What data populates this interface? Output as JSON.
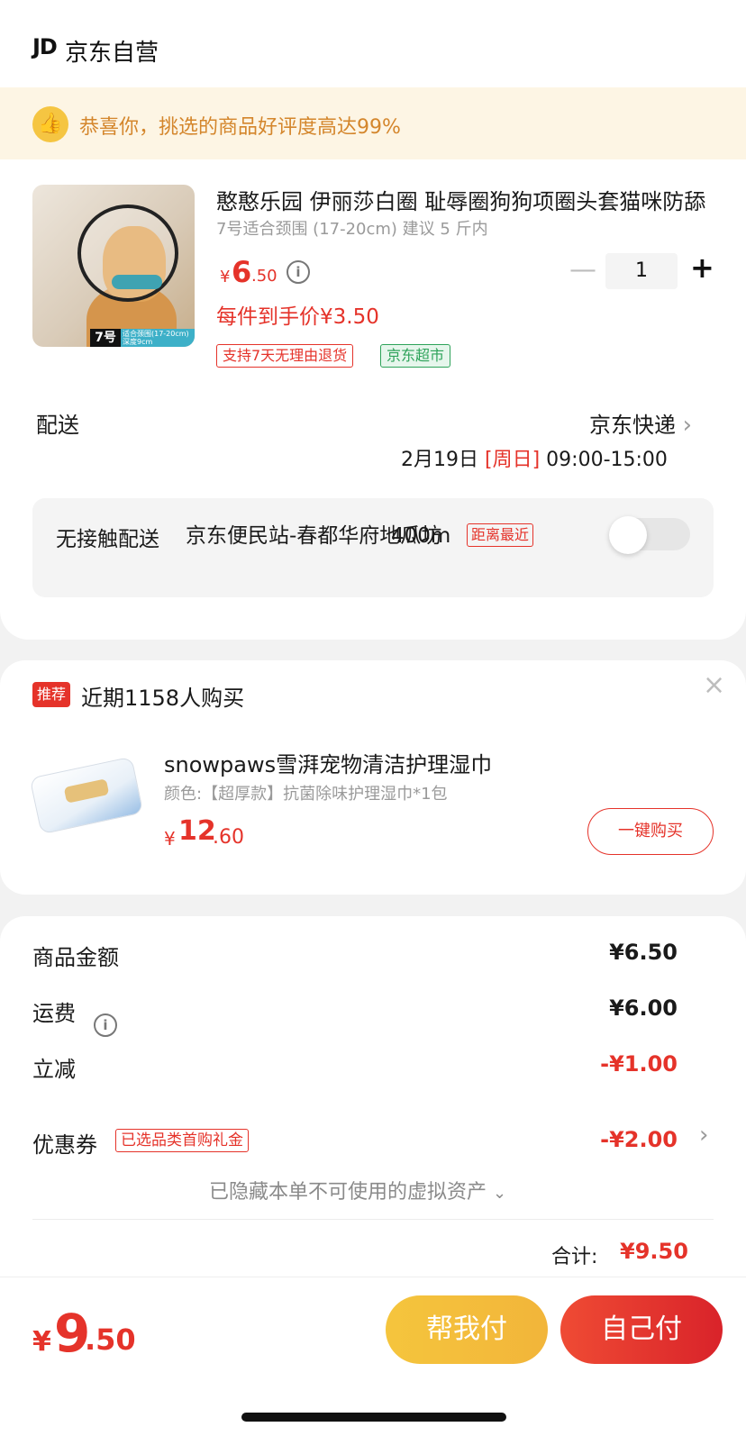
{
  "shop": {
    "logo": "JD",
    "name": "京东自营"
  },
  "banner": {
    "text": "恭喜你，挑选的商品好评度高达99%"
  },
  "product": {
    "title": "憨憨乐园 伊丽莎白圈 耻辱圈狗狗项圈头套猫咪防舔",
    "spec": "7号适合颈围 (17-20cm) 建议 5 斤内",
    "price_symbol": "¥",
    "price_int": "6",
    "price_dec": ".50",
    "quantity": "1",
    "deal_price": "每件到手价¥3.50",
    "tags": [
      "支持7天无理由退货",
      "京东超市"
    ],
    "image": {
      "size_label": "7号",
      "size_desc_line1": "适合颈围(17-20cm)",
      "size_desc_line2": "深度9cm"
    }
  },
  "delivery": {
    "label": "配送",
    "method": "京东快递",
    "date_prefix": "2月19日",
    "weekday": "[周日]",
    "time": "09:00-15:00"
  },
  "contactless": {
    "label": "无接触配送",
    "station": "京东便民站-春都华府地瓜坊",
    "distance": "400m",
    "badge": "距离最近",
    "enabled": false
  },
  "recommend": {
    "badge": "推荐",
    "title": "近期1158人购买",
    "product_name": "snowpaws雪湃宠物清洁护理湿巾",
    "product_spec": "颜色:【超厚款】抗菌除味护理湿巾*1包",
    "price_symbol": "¥",
    "price_int": "12",
    "price_dec": ".60",
    "buy_label": "一键购买"
  },
  "summary": {
    "items_label": "商品金额",
    "items_value": "¥6.50",
    "shipping_label": "运费",
    "shipping_value": "¥6.00",
    "discount_label": "立减",
    "discount_value": "-¥1.00",
    "coupon_label": "优惠券",
    "coupon_tag": "已选品类首购礼金",
    "coupon_value": "-¥2.00",
    "hidden_assets": "已隐藏本单不可使用的虚拟资产",
    "total_label": "合计:",
    "total_value": "¥9.50"
  },
  "bottom": {
    "price_symbol": "¥",
    "price_int": "9",
    "price_dec": ".50",
    "help_pay": "帮我付",
    "self_pay": "自己付"
  },
  "icons": {
    "thumb": "thumbs-up-icon",
    "info": "info-icon",
    "chevron": "chevron-right-icon",
    "close": "close-icon"
  },
  "colors": {
    "accent_red": "#e5332a",
    "banner_bg": "#fdf5e4",
    "banner_text": "#d4862c",
    "help_pay_bg": "#f5c53d"
  }
}
